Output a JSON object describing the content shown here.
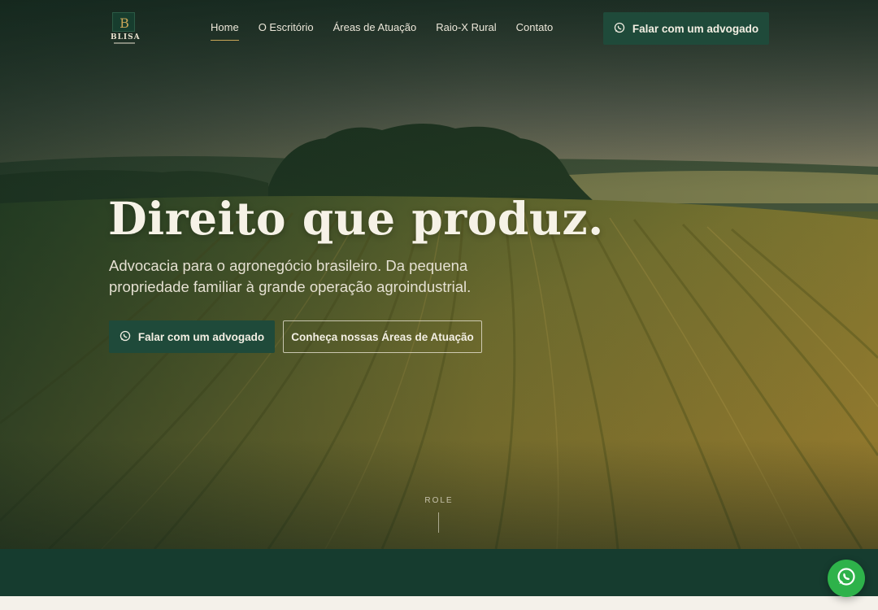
{
  "brand": {
    "name": "BLISA"
  },
  "nav": {
    "items": [
      {
        "label": "Home",
        "active": true
      },
      {
        "label": "O Escritório",
        "active": false
      },
      {
        "label": "Áreas de Atuação",
        "active": false
      },
      {
        "label": "Raio-X Rural",
        "active": false
      },
      {
        "label": "Contato",
        "active": false
      }
    ],
    "cta_label": "Falar com um advogado",
    "cta_icon": "whatsapp-icon"
  },
  "hero": {
    "headline": "Direito que produz.",
    "subtitle": "Advocacia para o agronegócio brasileiro. Da pequena propriedade familiar à grande operação agroindustrial.",
    "primary_button": "Falar com um advogado",
    "secondary_button": "Conheça nossas Áreas de Atuação",
    "scroll_label": "ROLE"
  },
  "floating": {
    "icon": "whatsapp-icon"
  },
  "colors": {
    "brand_green": "#1f4a3a",
    "band_green": "#163c2f",
    "accent_gold": "#c9a557",
    "whatsapp_green": "#2eb24a",
    "cream": "#f4f1ea"
  }
}
